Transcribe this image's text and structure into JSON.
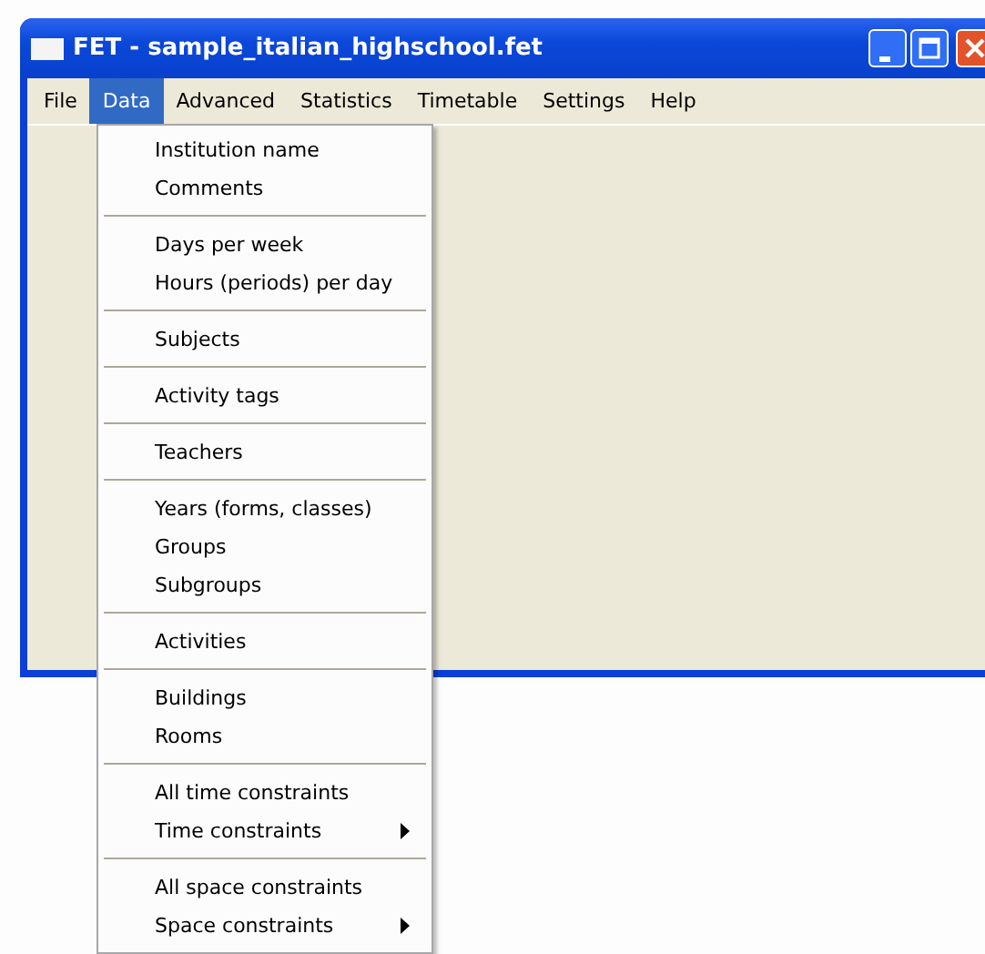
{
  "window": {
    "title": "FET - sample_italian_highschool.fet"
  },
  "menu_bar": [
    {
      "label": "File",
      "selected": false
    },
    {
      "label": "Data",
      "selected": true
    },
    {
      "label": "Advanced",
      "selected": false
    },
    {
      "label": "Statistics",
      "selected": false
    },
    {
      "label": "Timetable",
      "selected": false
    },
    {
      "label": "Settings",
      "selected": false
    },
    {
      "label": "Help",
      "selected": false
    }
  ],
  "dropdown_menu": {
    "groups": [
      [
        {
          "label": "Institution name",
          "submenu": false
        },
        {
          "label": "Comments",
          "submenu": false
        }
      ],
      [
        {
          "label": "Days per week",
          "submenu": false
        },
        {
          "label": "Hours (periods) per day",
          "submenu": false
        }
      ],
      [
        {
          "label": "Subjects",
          "submenu": false
        }
      ],
      [
        {
          "label": "Activity tags",
          "submenu": false
        }
      ],
      [
        {
          "label": "Teachers",
          "submenu": false
        }
      ],
      [
        {
          "label": "Years (forms, classes)",
          "submenu": false
        },
        {
          "label": "Groups",
          "submenu": false
        },
        {
          "label": "Subgroups",
          "submenu": false
        }
      ],
      [
        {
          "label": "Activities",
          "submenu": false
        }
      ],
      [
        {
          "label": "Buildings",
          "submenu": false
        },
        {
          "label": "Rooms",
          "submenu": false
        }
      ],
      [
        {
          "label": "All time constraints",
          "submenu": false
        },
        {
          "label": "Time constraints",
          "submenu": true
        }
      ],
      [
        {
          "label": "All space constraints",
          "submenu": false
        },
        {
          "label": "Space constraints",
          "submenu": true
        }
      ]
    ]
  }
}
